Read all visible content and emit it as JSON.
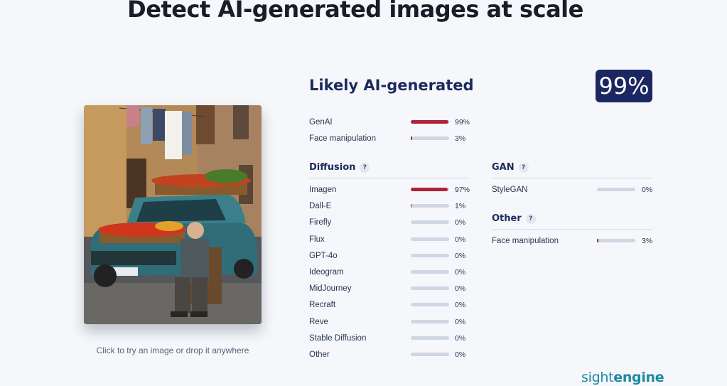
{
  "headline": "Detect AI-generated images at scale",
  "upload": {
    "caption": "Click to try an image or drop it anywhere"
  },
  "result": {
    "verdict": "Likely AI-generated",
    "score": "99%",
    "summary": [
      {
        "label": "GenAI",
        "value": 99,
        "pct": "99%"
      },
      {
        "label": "Face manipulation",
        "value": 3,
        "pct": "3%"
      }
    ]
  },
  "diffusion": {
    "title": "Diffusion",
    "help": "?",
    "items": [
      {
        "label": "Imagen",
        "value": 97,
        "pct": "97%"
      },
      {
        "label": "Dall-E",
        "value": 1,
        "pct": "1%"
      },
      {
        "label": "Firefly",
        "value": 0,
        "pct": "0%"
      },
      {
        "label": "Flux",
        "value": 0,
        "pct": "0%"
      },
      {
        "label": "GPT-4o",
        "value": 0,
        "pct": "0%"
      },
      {
        "label": "Ideogram",
        "value": 0,
        "pct": "0%"
      },
      {
        "label": "MidJourney",
        "value": 0,
        "pct": "0%"
      },
      {
        "label": "Recraft",
        "value": 0,
        "pct": "0%"
      },
      {
        "label": "Reve",
        "value": 0,
        "pct": "0%"
      },
      {
        "label": "Stable Diffusion",
        "value": 0,
        "pct": "0%"
      },
      {
        "label": "Other",
        "value": 0,
        "pct": "0%"
      }
    ]
  },
  "gan": {
    "title": "GAN",
    "help": "?",
    "items": [
      {
        "label": "StyleGAN",
        "value": 0,
        "pct": "0%"
      }
    ]
  },
  "other": {
    "title": "Other",
    "help": "?",
    "items": [
      {
        "label": "Face manipulation",
        "value": 3,
        "pct": "3%"
      }
    ]
  },
  "brand": {
    "light": "sight",
    "bold": "engine"
  },
  "colors": {
    "bar_fill": "#b0223a",
    "bar_track": "#d0d7e2",
    "badge": "#1c2660",
    "brand": "#1d8aa0"
  }
}
